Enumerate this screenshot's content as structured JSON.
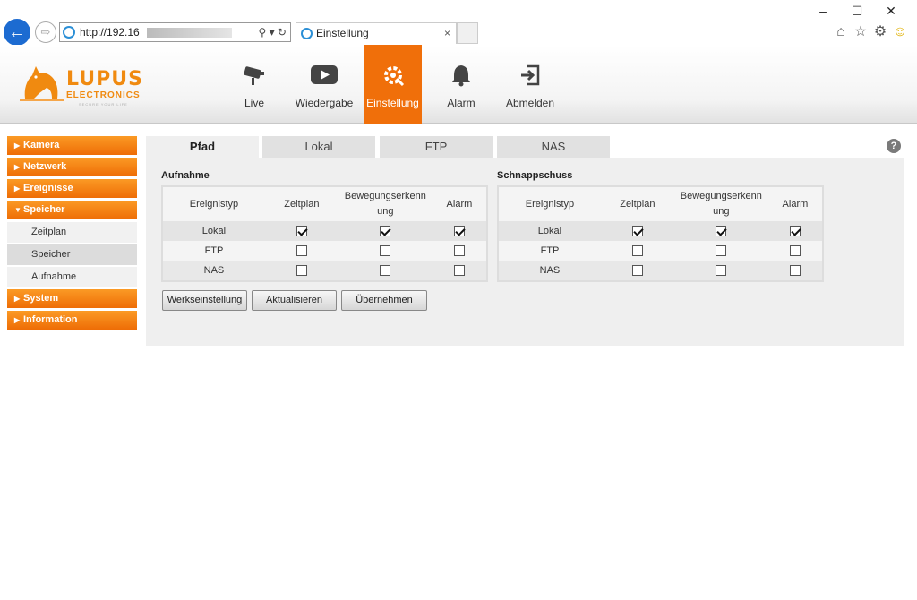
{
  "browser": {
    "address": "http://192.16",
    "tab_title": "Einstellung",
    "tab_close": "×",
    "window_controls": [
      "–",
      "☐",
      "✕"
    ],
    "toolbar_icons": [
      "home-icon",
      "star-icon",
      "gear-icon",
      "smiley-icon"
    ]
  },
  "logo": {
    "brand": "LUPUS",
    "sub": "ELECTRONICS",
    "tagline": "SECURE YOUR LIFE"
  },
  "nav": [
    {
      "label": "Live",
      "icon": "camera-icon"
    },
    {
      "label": "Wiedergabe",
      "icon": "play-icon"
    },
    {
      "label": "Einstellung",
      "icon": "settings-icon",
      "active": true
    },
    {
      "label": "Alarm",
      "icon": "bell-icon"
    },
    {
      "label": "Abmelden",
      "icon": "logout-icon"
    }
  ],
  "sidebar": {
    "kamera": "Kamera",
    "netzwerk": "Netzwerk",
    "ereignisse": "Ereignisse",
    "speicher": "Speicher",
    "speicher_sub": [
      "Zeitplan",
      "Speicher",
      "Aufnahme"
    ],
    "system": "System",
    "information": "Information"
  },
  "tabs": [
    "Pfad",
    "Lokal",
    "FTP",
    "NAS"
  ],
  "help": "?",
  "aufnahme": {
    "title": "Aufnahme",
    "headers": [
      "Ereignistyp",
      "Zeitplan",
      "Bewegungserkenn ung",
      "Alarm"
    ],
    "rows": [
      {
        "label": "Lokal",
        "checks": [
          true,
          true,
          true
        ]
      },
      {
        "label": "FTP",
        "checks": [
          false,
          false,
          false
        ]
      },
      {
        "label": "NAS",
        "checks": [
          false,
          false,
          false
        ]
      }
    ]
  },
  "schnappschuss": {
    "title": "Schnappschuss",
    "headers": [
      "Ereignistyp",
      "Zeitplan",
      "Bewegungserkenn ung",
      "Alarm"
    ],
    "rows": [
      {
        "label": "Lokal",
        "checks": [
          true,
          true,
          true
        ]
      },
      {
        "label": "FTP",
        "checks": [
          false,
          false,
          false
        ]
      },
      {
        "label": "NAS",
        "checks": [
          false,
          false,
          false
        ]
      }
    ]
  },
  "buttons": {
    "default": "Werkseinstellung",
    "refresh": "Aktualisieren",
    "apply": "Übernehmen"
  },
  "colors": {
    "accent": "#f06f0a",
    "sidebar_gradient_top": "#fb9a25",
    "ie_blue": "#1c6bd1"
  }
}
